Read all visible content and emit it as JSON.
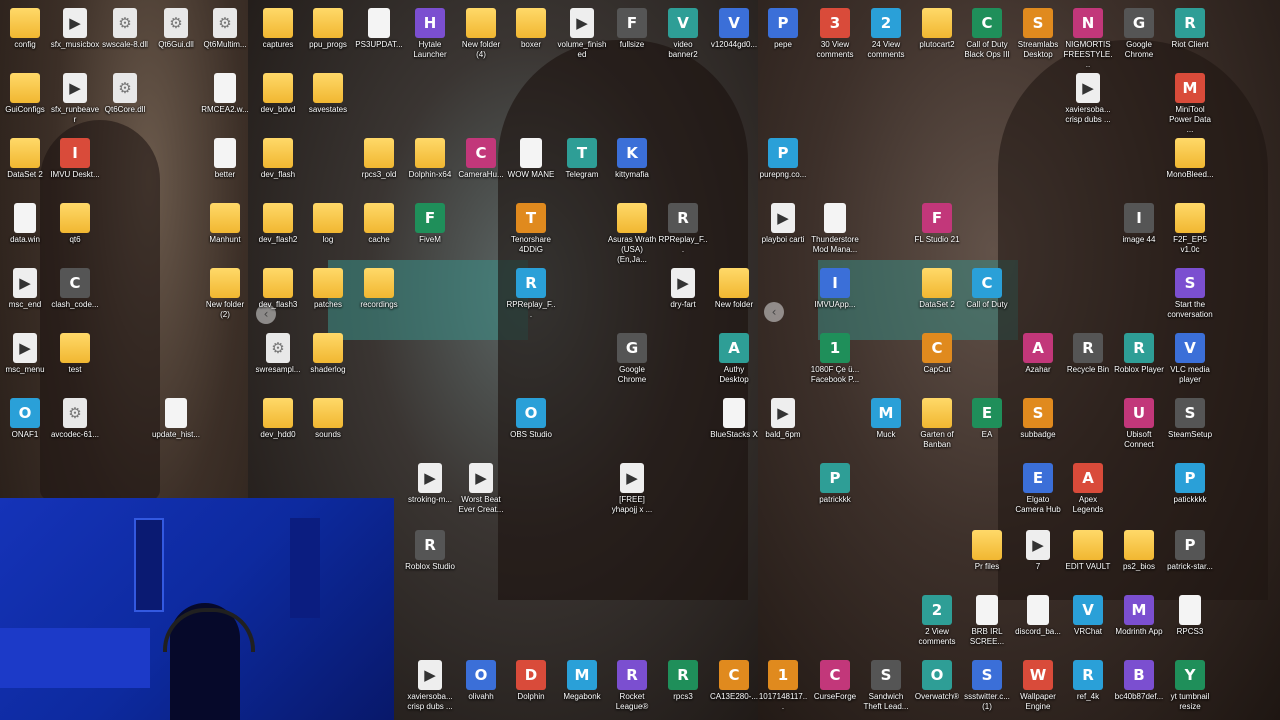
{
  "panels": [
    {
      "id": "p1",
      "icons": [
        {
          "label": "config",
          "type": "folder"
        },
        {
          "label": "sfx_musicbox",
          "type": "video"
        },
        {
          "label": "swscale-8.dll",
          "type": "gear"
        },
        {
          "label": "Qt6Gui.dll",
          "type": "gear"
        },
        {
          "label": "Qt6Multim...",
          "type": "gear"
        },
        {
          "label": "GuiConfigs",
          "type": "folder"
        },
        {
          "label": "sfx_runbeaver",
          "type": "video"
        },
        {
          "label": "Qt6Core.dll",
          "type": "gear"
        },
        {
          "label": "RMCEA2.w...",
          "type": "file"
        },
        {
          "label": "DataSet 2",
          "type": "folder"
        },
        {
          "label": "IMVU Deskt...",
          "type": "app"
        },
        {
          "label": "better",
          "type": "file"
        },
        {
          "label": "data.win",
          "type": "file"
        },
        {
          "label": "qt6",
          "type": "folder"
        },
        {
          "label": "Manhunt",
          "type": "folder"
        },
        {
          "label": "msc_end",
          "type": "video"
        },
        {
          "label": "clash_code...",
          "type": "app"
        },
        {
          "label": "New folder (2)",
          "type": "folder"
        },
        {
          "label": "msc_menu",
          "type": "video"
        },
        {
          "label": "test",
          "type": "folder"
        },
        {
          "label": "ONAF1",
          "type": "app"
        },
        {
          "label": "avcodec-61...",
          "type": "gear"
        },
        {
          "label": "update_hist...",
          "type": "file"
        }
      ]
    },
    {
      "id": "p2",
      "icons": [
        {
          "label": "captures",
          "type": "folder"
        },
        {
          "label": "ppu_progs",
          "type": "folder"
        },
        {
          "label": "PS3UPDAT...",
          "type": "file"
        },
        {
          "label": "Hytale Launcher",
          "type": "app"
        },
        {
          "label": "New folder (4)",
          "type": "folder"
        },
        {
          "label": "boxer",
          "type": "folder"
        },
        {
          "label": "volume_finished",
          "type": "video"
        },
        {
          "label": "fullsize",
          "type": "app"
        },
        {
          "label": "video banner2",
          "type": "app"
        },
        {
          "label": "v12044gd0...",
          "type": "app"
        },
        {
          "label": "dev_bdvd",
          "type": "folder"
        },
        {
          "label": "savestates",
          "type": "folder"
        },
        {
          "label": "dev_flash",
          "type": "folder"
        },
        {
          "label": "rpcs3_old",
          "type": "folder"
        },
        {
          "label": "Dolphin-x64",
          "type": "folder"
        },
        {
          "label": "CameraHu...",
          "type": "app"
        },
        {
          "label": "WOW MANE",
          "type": "file"
        },
        {
          "label": "Telegram",
          "type": "app"
        },
        {
          "label": "kittymafia",
          "type": "app"
        },
        {
          "label": "dev_flash2",
          "type": "folder"
        },
        {
          "label": "log",
          "type": "folder"
        },
        {
          "label": "cache",
          "type": "folder"
        },
        {
          "label": "FiveM",
          "type": "app"
        },
        {
          "label": "Tenorshare 4DDiG",
          "type": "app"
        },
        {
          "label": "Asuras Wrath (USA) (En,Ja...",
          "type": "folder"
        },
        {
          "label": "RPReplay_F...",
          "type": "app"
        },
        {
          "label": "dev_flash3",
          "type": "folder"
        },
        {
          "label": "patches",
          "type": "folder"
        },
        {
          "label": "recordings",
          "type": "folder"
        },
        {
          "label": "RPReplay_F...",
          "type": "app"
        },
        {
          "label": "dry-fart",
          "type": "video"
        },
        {
          "label": "New folder",
          "type": "folder"
        },
        {
          "label": "swresampl...",
          "type": "gear"
        },
        {
          "label": "shaderlog",
          "type": "folder"
        },
        {
          "label": "Google Chrome",
          "type": "app"
        },
        {
          "label": "Authy Desktop",
          "type": "app"
        },
        {
          "label": "dev_hdd0",
          "type": "folder"
        },
        {
          "label": "sounds",
          "type": "folder"
        },
        {
          "label": "OBS Studio",
          "type": "app"
        },
        {
          "label": "BlueStacks X",
          "type": "file"
        },
        {
          "label": "stroking-m...",
          "type": "video"
        },
        {
          "label": "Worst Beat Ever Creat...",
          "type": "video"
        },
        {
          "label": "[FREE] yhapojj x ...",
          "type": "video"
        },
        {
          "label": "Roblox Studio",
          "type": "app"
        },
        {
          "label": "xaviersoba... crisp dubs ...",
          "type": "video"
        },
        {
          "label": "olivahh",
          "type": "app"
        },
        {
          "label": "Dolphin",
          "type": "app"
        },
        {
          "label": "Megabonk",
          "type": "app"
        },
        {
          "label": "Rocket League®",
          "type": "app"
        },
        {
          "label": "rpcs3",
          "type": "app"
        },
        {
          "label": "CA13E280-...",
          "type": "app"
        }
      ]
    },
    {
      "id": "p3",
      "icons": [
        {
          "label": "pepe",
          "type": "app"
        },
        {
          "label": "30 View comments",
          "type": "app"
        },
        {
          "label": "24 View comments",
          "type": "app"
        },
        {
          "label": "plutocart2",
          "type": "folder"
        },
        {
          "label": "Call of Duty Black Ops III",
          "type": "app"
        },
        {
          "label": "Streamlabs Desktop",
          "type": "app"
        },
        {
          "label": "NIGMORTIS FREESTYLE...",
          "type": "app"
        },
        {
          "label": "Google Chrome",
          "type": "app"
        },
        {
          "label": "Riot Client",
          "type": "app"
        },
        {
          "label": "xaviersoba... crisp dubs ...",
          "type": "video"
        },
        {
          "label": "MiniTool Power Data ...",
          "type": "app"
        },
        {
          "label": "purepng.co...",
          "type": "app"
        },
        {
          "label": "MonoBleed...",
          "type": "folder"
        },
        {
          "label": "playboi carti",
          "type": "video"
        },
        {
          "label": "Thunderstore Mod Mana...",
          "type": "file"
        },
        {
          "label": "FL Studio 21",
          "type": "app"
        },
        {
          "label": "image 44",
          "type": "app"
        },
        {
          "label": "F2F_EP5 v1.0c",
          "type": "folder"
        },
        {
          "label": "IMVUApp...",
          "type": "app"
        },
        {
          "label": "DataSet 2",
          "type": "folder"
        },
        {
          "label": "Call of Duty",
          "type": "app"
        },
        {
          "label": "Start the conversation",
          "type": "app"
        },
        {
          "label": "1080F Çe ü... Facebook P...",
          "type": "app"
        },
        {
          "label": "CapCut",
          "type": "app"
        },
        {
          "label": "Azahar",
          "type": "app"
        },
        {
          "label": "Recycle Bin",
          "type": "app"
        },
        {
          "label": "Roblox Player",
          "type": "app"
        },
        {
          "label": "VLC media player",
          "type": "app"
        },
        {
          "label": "bald_6pm",
          "type": "video"
        },
        {
          "label": "Muck",
          "type": "app"
        },
        {
          "label": "Garten of Banban",
          "type": "folder"
        },
        {
          "label": "EA",
          "type": "app"
        },
        {
          "label": "subbadge",
          "type": "app"
        },
        {
          "label": "Ubisoft Connect",
          "type": "app"
        },
        {
          "label": "SteamSetup",
          "type": "app"
        },
        {
          "label": "patrickkk",
          "type": "app"
        },
        {
          "label": "Elgato Camera Hub",
          "type": "app"
        },
        {
          "label": "Apex Legends",
          "type": "app"
        },
        {
          "label": "patickkkk",
          "type": "app"
        },
        {
          "label": "Pr files",
          "type": "folder"
        },
        {
          "label": "7",
          "type": "video"
        },
        {
          "label": "EDIT VAULT",
          "type": "folder"
        },
        {
          "label": "ps2_bios",
          "type": "folder"
        },
        {
          "label": "patrick-star...",
          "type": "app"
        },
        {
          "label": "2 View comments",
          "type": "app"
        },
        {
          "label": "BRB IRL SCREE...",
          "type": "file"
        },
        {
          "label": "discord_ba...",
          "type": "file"
        },
        {
          "label": "VRChat",
          "type": "app"
        },
        {
          "label": "Modrinth App",
          "type": "app"
        },
        {
          "label": "RPCS3",
          "type": "file"
        },
        {
          "label": "1017148117...",
          "type": "app"
        },
        {
          "label": "CurseForge",
          "type": "app"
        },
        {
          "label": "Sandwich Theft Lead...",
          "type": "app"
        },
        {
          "label": "Overwatch®",
          "type": "app"
        },
        {
          "label": "ssstwitter.c... (1)",
          "type": "app"
        },
        {
          "label": "Wallpaper Engine",
          "type": "app"
        },
        {
          "label": "ref_4k",
          "type": "app"
        },
        {
          "label": "bc40b87def...",
          "type": "app"
        },
        {
          "label": "yt tumbnail resize",
          "type": "app"
        }
      ]
    }
  ],
  "colors": {
    "folder": "#f6c343",
    "webcam": "#1533b8"
  }
}
